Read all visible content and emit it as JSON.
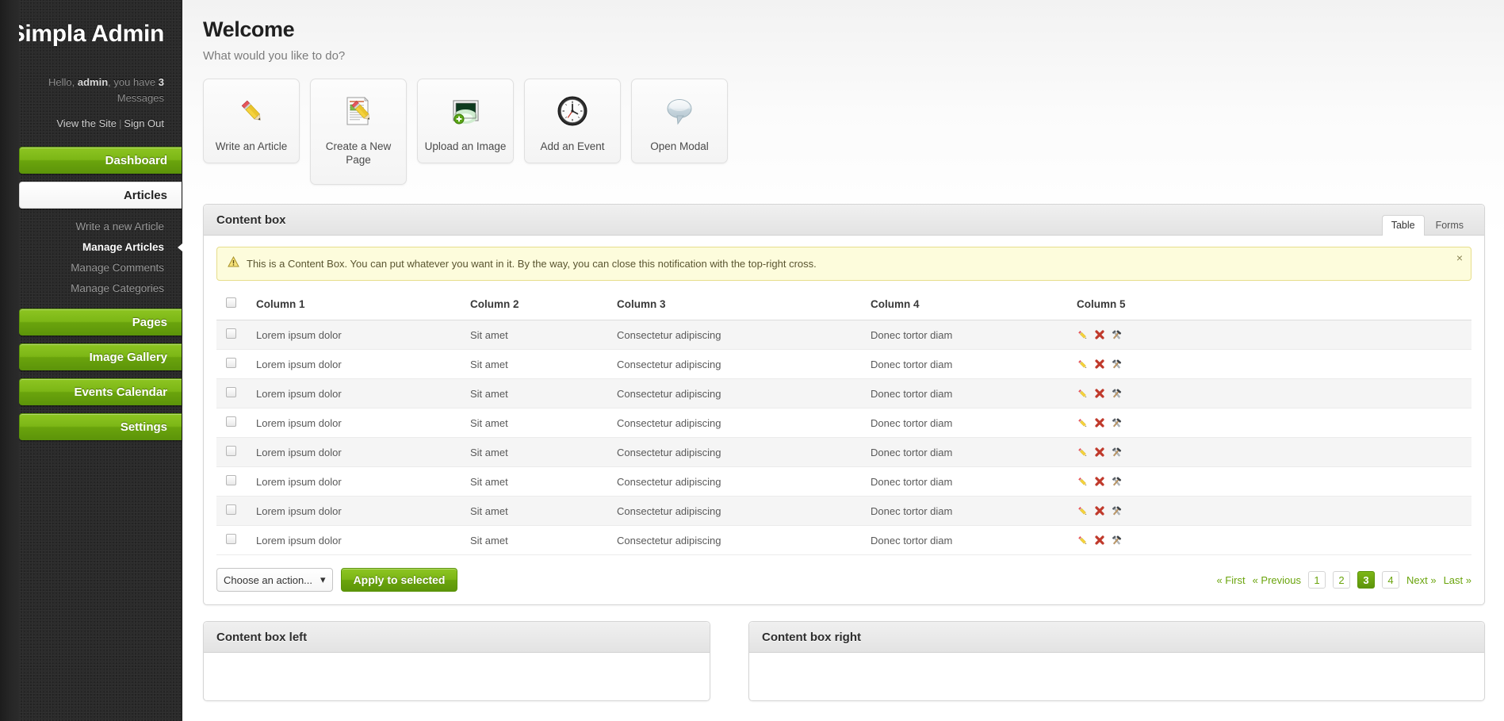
{
  "sidebar": {
    "brand": "Simpla Admin",
    "greeting": {
      "pre": "Hello, ",
      "user": "admin",
      "mid": ", you have ",
      "count": "3",
      "post": " Messages"
    },
    "links": {
      "view_site": "View the Site",
      "separator": "|",
      "sign_out": "Sign Out"
    },
    "nav": [
      {
        "label": "Dashboard",
        "style": "green"
      },
      {
        "label": "Articles",
        "style": "white"
      },
      {
        "label": "Pages",
        "style": "green"
      },
      {
        "label": "Image Gallery",
        "style": "green"
      },
      {
        "label": "Events Calendar",
        "style": "green"
      },
      {
        "label": "Settings",
        "style": "green"
      }
    ],
    "subnav": [
      {
        "label": "Write a new Article",
        "current": false
      },
      {
        "label": "Manage Articles",
        "current": true
      },
      {
        "label": "Manage Comments",
        "current": false
      },
      {
        "label": "Manage Categories",
        "current": false
      }
    ]
  },
  "header": {
    "title": "Welcome",
    "subtitle": "What would you like to do?"
  },
  "shortcuts": [
    {
      "label": "Write an Article",
      "icon": "pencil-icon"
    },
    {
      "label": "Create a New Page",
      "icon": "page-edit-icon"
    },
    {
      "label": "Upload an Image",
      "icon": "image-add-icon"
    },
    {
      "label": "Add an Event",
      "icon": "clock-icon"
    },
    {
      "label": "Open Modal",
      "icon": "speech-bubble-icon"
    }
  ],
  "content_box": {
    "title": "Content box",
    "tabs": [
      {
        "label": "Table",
        "active": true
      },
      {
        "label": "Forms",
        "active": false
      }
    ],
    "notice": {
      "text": "This is a Content Box. You can put whatever you want in it. By the way, you can close this notification with the top-right cross.",
      "close": "×",
      "icon": "warning-icon"
    },
    "table": {
      "columns": [
        "Column 1",
        "Column 2",
        "Column 3",
        "Column 4",
        "Column 5"
      ],
      "rows": [
        {
          "c1": "Lorem ipsum dolor",
          "c2": "Sit amet",
          "c3": "Consectetur adipiscing",
          "c4": "Donec tortor diam"
        },
        {
          "c1": "Lorem ipsum dolor",
          "c2": "Sit amet",
          "c3": "Consectetur adipiscing",
          "c4": "Donec tortor diam"
        },
        {
          "c1": "Lorem ipsum dolor",
          "c2": "Sit amet",
          "c3": "Consectetur adipiscing",
          "c4": "Donec tortor diam"
        },
        {
          "c1": "Lorem ipsum dolor",
          "c2": "Sit amet",
          "c3": "Consectetur adipiscing",
          "c4": "Donec tortor diam"
        },
        {
          "c1": "Lorem ipsum dolor",
          "c2": "Sit amet",
          "c3": "Consectetur adipiscing",
          "c4": "Donec tortor diam"
        },
        {
          "c1": "Lorem ipsum dolor",
          "c2": "Sit amet",
          "c3": "Consectetur adipiscing",
          "c4": "Donec tortor diam"
        },
        {
          "c1": "Lorem ipsum dolor",
          "c2": "Sit amet",
          "c3": "Consectetur adipiscing",
          "c4": "Donec tortor diam"
        },
        {
          "c1": "Lorem ipsum dolor",
          "c2": "Sit amet",
          "c3": "Consectetur adipiscing",
          "c4": "Donec tortor diam"
        }
      ],
      "row_actions": [
        "edit-icon",
        "delete-icon",
        "tools-icon"
      ]
    },
    "footer": {
      "action_select": {
        "value": "Choose an action...",
        "caret": "▾"
      },
      "apply_button": "Apply to selected",
      "pagination": {
        "first": "« First",
        "previous": "« Previous",
        "pages": [
          "1",
          "2",
          "3",
          "4"
        ],
        "current": "3",
        "next": "Next »",
        "last": "Last »"
      }
    }
  },
  "bottom_boxes": [
    {
      "title": "Content box left"
    },
    {
      "title": "Content box right"
    }
  ],
  "colors": {
    "accent_green": "#7cb616",
    "link_green": "#62a518",
    "sidebar_dark": "#2b2b2b",
    "notice_yellow": "#fdfcdc"
  }
}
